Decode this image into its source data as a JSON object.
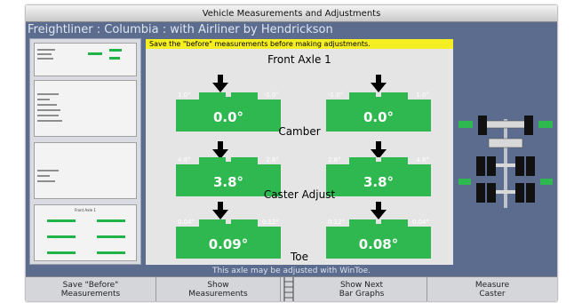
{
  "window": {
    "title": "Vehicle Measurements and Adjustments"
  },
  "vehicle": {
    "title": "Freightliner : Columbia : with Airliner by Hendrickson"
  },
  "banner": {
    "text": "Save the \"before\" measurements before making adjustments."
  },
  "axle": {
    "title": "Front Axle 1"
  },
  "sections": [
    {
      "label": "Camber",
      "left": {
        "min": "1.0°",
        "max": "-1.0°",
        "value": "0.0°"
      },
      "right": {
        "min": "-1.0°",
        "max": "1.0°",
        "value": "0.0°"
      }
    },
    {
      "label": "Caster Adjust",
      "left": {
        "min": "4.8°",
        "max": "2.8°",
        "value": "3.8°"
      },
      "right": {
        "min": "2.8°",
        "max": "4.8°",
        "value": "3.8°"
      }
    },
    {
      "label": "Toe",
      "left": {
        "min": "0.04°",
        "max": "0.12°",
        "value": "0.09°"
      },
      "right": {
        "min": "0.12°",
        "max": "0.04°",
        "value": "0.08°"
      }
    }
  ],
  "footnote": "This axle may be adjusted with WinToe.",
  "buttons": [
    {
      "line1": "Save \"Before\"",
      "line2": "Measurements"
    },
    {
      "line1": "Show",
      "line2": "Measurements"
    },
    {
      "line1": "Show Next",
      "line2": "Bar Graphs"
    },
    {
      "line1": "Measure",
      "line2": "Caster"
    }
  ],
  "left_panel": {
    "mini_title": "Front Axle 1"
  },
  "colors": {
    "gauge": "#2fb84f",
    "banner": "#f4ee22",
    "window": "#5b6c8e"
  },
  "icons": {
    "ladder": "ladder-icon",
    "vehicle": "vehicle-diagram-icon",
    "arrow": "down-arrow-icon"
  }
}
